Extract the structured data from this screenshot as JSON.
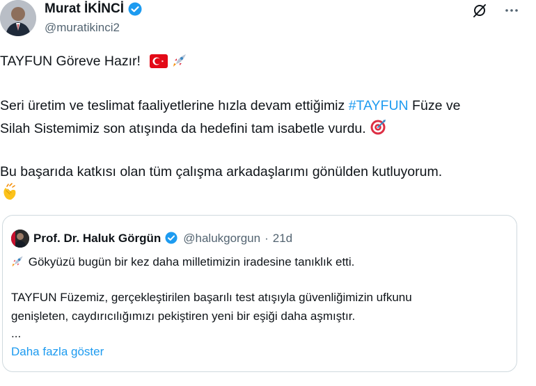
{
  "author": {
    "name": "Murat İKİNCİ",
    "handle": "@muratikinci2"
  },
  "colors": {
    "link": "#1d9bf0",
    "verified": "#1d9bf0",
    "text": "#0f1419",
    "muted": "#536471"
  },
  "icons": {
    "grok": "grok-icon",
    "more": "more-icon",
    "verified": "verified-badge-icon",
    "flag": "turkey-flag-emoji",
    "rocket": "rocket-emoji",
    "target": "target-emoji",
    "clap": "clapping-hands-emoji"
  },
  "tweet": {
    "line1": "TAYFUN Göreve Hazır!",
    "line2_before": "Seri üretim ve teslimat faaliyetlerine hızla devam ettiğimiz ",
    "hashtag": "#TAYFUN",
    "line2_after": " Füze ve",
    "line3": "Silah Sistemimiz son atışında da hedefini tam isabetle vurdu.",
    "line4": "Bu başarıda katkısı olan tüm çalışma arkadaşlarımı gönülden kutluyorum."
  },
  "quote": {
    "name": "Prof. Dr. Haluk Görgün",
    "handle": "@halukgorgun",
    "separator": "·",
    "time": "21d",
    "line1": "Gökyüzü bugün bir kez daha milletimizin iradesine tanıklık etti.",
    "line2": "TAYFUN Füzemiz, gerçekleştirilen başarılı test atışıyla güvenliğimizin ufkunu",
    "line3": "genişleten, caydırıcılığımızı pekiştiren yeni bir eşiği daha aşmıştır.",
    "ellipsis": "...",
    "show_more": "Daha fazla göster"
  }
}
